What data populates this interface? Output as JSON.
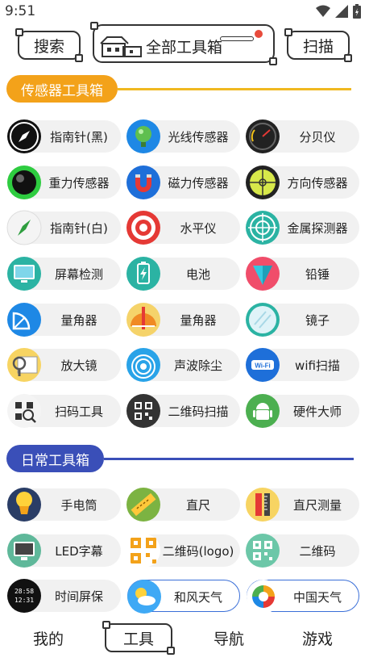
{
  "status": {
    "time": "9:51"
  },
  "topbar": {
    "search": "搜索",
    "all_tools": "全部工具箱",
    "scan": "扫描"
  },
  "sections": {
    "sensors": "传感器工具箱",
    "daily": "日常工具箱"
  },
  "sensor_tools": [
    {
      "label": "指南针(黑)",
      "icon": "compass-black-icon"
    },
    {
      "label": "光线传感器",
      "icon": "light-sensor-icon"
    },
    {
      "label": "分贝仪",
      "icon": "decibel-meter-icon"
    },
    {
      "label": "重力传感器",
      "icon": "gravity-sensor-icon"
    },
    {
      "label": "磁力传感器",
      "icon": "magnet-icon"
    },
    {
      "label": "方向传感器",
      "icon": "level-bubble-icon"
    },
    {
      "label": "指南针(白)",
      "icon": "compass-white-icon"
    },
    {
      "label": "水平仪",
      "icon": "target-icon"
    },
    {
      "label": "金属探测器",
      "icon": "radar-icon"
    },
    {
      "label": "屏幕检测",
      "icon": "monitor-icon"
    },
    {
      "label": "电池",
      "icon": "battery-icon"
    },
    {
      "label": "铅锤",
      "icon": "plumb-bob-icon"
    },
    {
      "label": "量角器",
      "icon": "protractor-blue-icon"
    },
    {
      "label": "量角器",
      "icon": "protractor-orange-icon"
    },
    {
      "label": "镜子",
      "icon": "mirror-icon"
    },
    {
      "label": "放大镜",
      "icon": "magnifier-icon"
    },
    {
      "label": "声波除尘",
      "icon": "sound-wave-icon"
    },
    {
      "label": "wifi扫描",
      "icon": "wifi-icon"
    },
    {
      "label": "扫码工具",
      "icon": "qr-scan-icon"
    },
    {
      "label": "二维码扫描",
      "icon": "qr-code-icon"
    },
    {
      "label": "硬件大师",
      "icon": "android-icon"
    }
  ],
  "daily_tools": [
    {
      "label": "手电筒",
      "icon": "flashlight-icon"
    },
    {
      "label": "直尺",
      "icon": "ruler-icon"
    },
    {
      "label": "直尺测量",
      "icon": "ruler-measure-icon"
    },
    {
      "label": "LED字幕",
      "icon": "led-monitor-icon"
    },
    {
      "label": "二维码(logo)",
      "icon": "qr-logo-icon"
    },
    {
      "label": "二维码",
      "icon": "qr-generate-icon"
    },
    {
      "label": "时间屏保",
      "icon": "clock-screen-icon"
    },
    {
      "label": "和风天气",
      "icon": "weather-icon"
    },
    {
      "label": "中国天气",
      "icon": "china-weather-icon"
    }
  ],
  "tabs": {
    "mine": "我的",
    "tools": "工具",
    "nav": "导航",
    "games": "游戏"
  },
  "colors": {
    "sensors_accent": "#f3a21a",
    "daily_accent": "#3a4fb8"
  }
}
